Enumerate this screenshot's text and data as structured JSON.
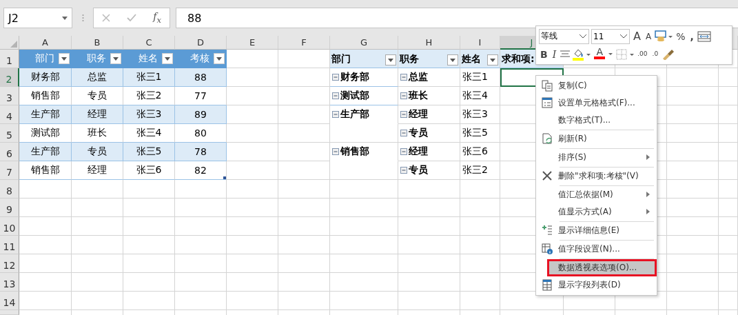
{
  "name_box": "J2",
  "formula_bar": {
    "function_label": "f$_{x}$",
    "value": "88"
  },
  "columns": [
    {
      "label": "A",
      "selected": false
    },
    {
      "label": "B",
      "selected": false
    },
    {
      "label": "C",
      "selected": false
    },
    {
      "label": "D",
      "selected": false
    },
    {
      "label": "E",
      "selected": false
    },
    {
      "label": "F",
      "selected": false
    },
    {
      "label": "G",
      "selected": false
    },
    {
      "label": "H",
      "selected": false
    },
    {
      "label": "I",
      "selected": false
    },
    {
      "label": "J",
      "selected": true
    }
  ],
  "rows": [
    {
      "label": "1",
      "selected": false
    },
    {
      "label": "2",
      "selected": true
    },
    {
      "label": "3",
      "selected": false
    },
    {
      "label": "4",
      "selected": false
    },
    {
      "label": "5",
      "selected": false
    },
    {
      "label": "6",
      "selected": false
    },
    {
      "label": "7",
      "selected": false
    },
    {
      "label": "8",
      "selected": false
    },
    {
      "label": "9",
      "selected": false
    },
    {
      "label": "10",
      "selected": false
    },
    {
      "label": "11",
      "selected": false
    },
    {
      "label": "12",
      "selected": false
    },
    {
      "label": "13",
      "selected": false
    },
    {
      "label": "14",
      "selected": false
    }
  ],
  "source_table": {
    "headers": [
      "部门",
      "职务",
      "姓名",
      "考核"
    ],
    "rows": [
      [
        "财务部",
        "总监",
        "张三1",
        "88"
      ],
      [
        "销售部",
        "专员",
        "张三2",
        "77"
      ],
      [
        "生产部",
        "经理",
        "张三3",
        "89"
      ],
      [
        "测试部",
        "班长",
        "张三4",
        "80"
      ],
      [
        "生产部",
        "专员",
        "张三5",
        "78"
      ],
      [
        "销售部",
        "经理",
        "张三6",
        "82"
      ]
    ]
  },
  "pivot_table": {
    "headers": [
      "部门",
      "职务",
      "姓名",
      "求和项:"
    ],
    "rows": [
      {
        "department": "财务部",
        "role": "总监",
        "name": "张三1"
      },
      {
        "department": "测试部",
        "role": "班长",
        "name": "张三4"
      },
      {
        "department": "生产部",
        "role": "经理",
        "name": "张三3"
      },
      {
        "role": "专员",
        "name": "张三5"
      },
      {
        "department": "销售部",
        "role": "经理",
        "name": "张三6"
      },
      {
        "role": "专员",
        "name": "张三2"
      }
    ]
  },
  "mini_toolbar": {
    "font": "等线",
    "size": "11",
    "percent": "%",
    "comma": ",",
    "bold": "B",
    "italic": "I",
    "grow_font": "A",
    "shrink_font": "A",
    "font_color": "A",
    "increase_decimal": ".00",
    "decrease_decimal": ".0"
  },
  "context_menu": [
    {
      "label": "复制(C)",
      "submenu": false,
      "separator_after": false,
      "selected": false
    },
    {
      "label": "设置单元格格式(F)...",
      "submenu": false,
      "separator_after": false,
      "selected": false
    },
    {
      "label": "数字格式(T)...",
      "submenu": false,
      "separator_after": true,
      "selected": false
    },
    {
      "label": "刷新(R)",
      "submenu": false,
      "separator_after": true,
      "selected": false
    },
    {
      "label": "排序(S)",
      "submenu": true,
      "separator_after": true,
      "selected": false
    },
    {
      "label": "删除\"求和项:考核\"(V)",
      "submenu": false,
      "separator_after": true,
      "selected": false
    },
    {
      "label": "值汇总依据(M)",
      "submenu": true,
      "separator_after": false,
      "selected": false
    },
    {
      "label": "值显示方式(A)",
      "submenu": true,
      "separator_after": true,
      "selected": false
    },
    {
      "label": "显示详细信息(E)",
      "submenu": false,
      "separator_after": true,
      "selected": false
    },
    {
      "label": "值字段设置(N)...",
      "submenu": false,
      "separator_after": true,
      "selected": false
    },
    {
      "label": "数据透视表选项(O)...",
      "submenu": false,
      "separator_after": false,
      "selected": true
    },
    {
      "label": "显示字段列表(D)",
      "submenu": false,
      "separator_after": false,
      "selected": false
    }
  ]
}
